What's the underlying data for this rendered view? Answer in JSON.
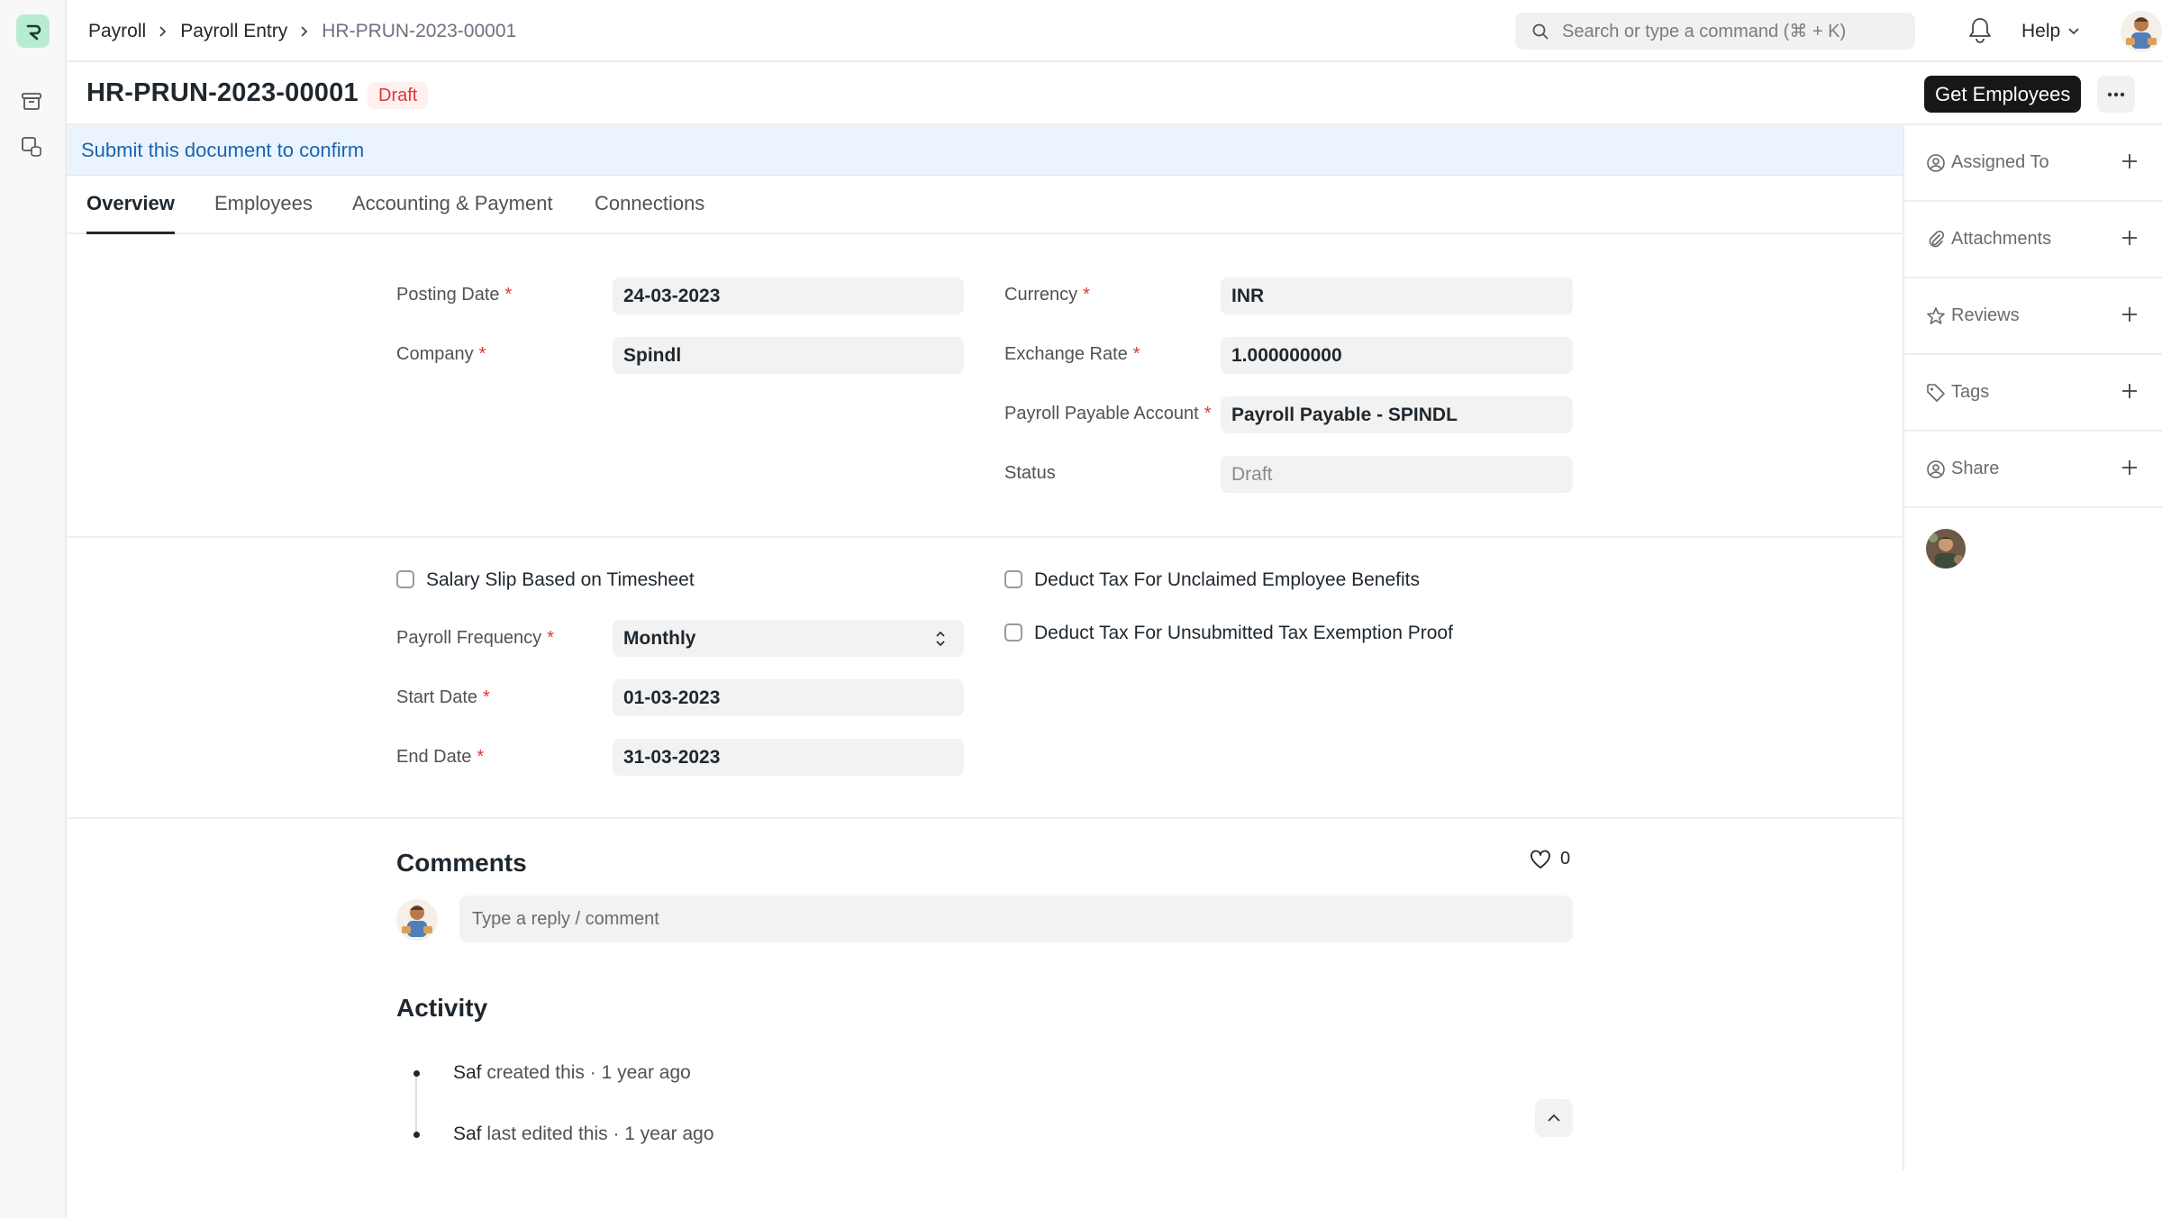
{
  "breadcrumbs": [
    {
      "label": "Payroll"
    },
    {
      "label": "Payroll Entry"
    },
    {
      "label": "HR-PRUN-2023-00001"
    }
  ],
  "navbar": {
    "search_placeholder": "Search or type a command (⌘ + K)",
    "help_label": "Help"
  },
  "document": {
    "title": "HR-PRUN-2023-00001",
    "status_badge": "Draft",
    "primary_action": "Get Employees"
  },
  "banner": {
    "text": "Submit this document to confirm"
  },
  "tabs": [
    {
      "label": "Overview",
      "active": true
    },
    {
      "label": "Employees",
      "active": false
    },
    {
      "label": "Accounting & Payment",
      "active": false
    },
    {
      "label": "Connections",
      "active": false
    }
  ],
  "form": {
    "posting_date": {
      "label": "Posting Date",
      "value": "24-03-2023",
      "required": true
    },
    "company": {
      "label": "Company",
      "value": "Spindl",
      "required": true
    },
    "currency": {
      "label": "Currency",
      "value": "INR",
      "required": true
    },
    "exchange_rate": {
      "label": "Exchange Rate",
      "value": "1.000000000",
      "required": true
    },
    "payroll_payable_account": {
      "label": "Payroll Payable Account",
      "value": "Payroll Payable - SPINDL",
      "required": true
    },
    "status": {
      "label": "Status",
      "value": "Draft",
      "required": false
    },
    "salary_slip_timesheet": {
      "label": "Salary Slip Based on Timesheet",
      "checked": false
    },
    "payroll_frequency": {
      "label": "Payroll Frequency",
      "value": "Monthly",
      "required": true
    },
    "start_date": {
      "label": "Start Date",
      "value": "01-03-2023",
      "required": true
    },
    "end_date": {
      "label": "End Date",
      "value": "31-03-2023",
      "required": true
    },
    "deduct_unclaimed": {
      "label": "Deduct Tax For Unclaimed Employee Benefits",
      "checked": false
    },
    "deduct_unsubmitted": {
      "label": "Deduct Tax For Unsubmitted Tax Exemption Proof",
      "checked": false
    },
    "required_marker": "*"
  },
  "sidebar": {
    "items": [
      {
        "label": "Assigned To",
        "icon": "assign-icon"
      },
      {
        "label": "Attachments",
        "icon": "paperclip-icon"
      },
      {
        "label": "Reviews",
        "icon": "star-icon"
      },
      {
        "label": "Tags",
        "icon": "tag-icon"
      },
      {
        "label": "Share",
        "icon": "share-icon"
      }
    ]
  },
  "comments": {
    "heading": "Comments",
    "like_count": "0",
    "placeholder": "Type a reply / comment"
  },
  "activity": {
    "heading": "Activity",
    "items": [
      {
        "user": "Saf",
        "action": "created this",
        "time": "· 1 year ago"
      },
      {
        "user": "Saf",
        "action": "last edited this",
        "time": "· 1 year ago"
      }
    ]
  },
  "colors": {
    "accent_dark": "#171717",
    "required": "#e03636",
    "banner_text": "#1b64b0",
    "banner_bg": "#ebf4fe",
    "logo_bg": "#b7ecd1"
  }
}
